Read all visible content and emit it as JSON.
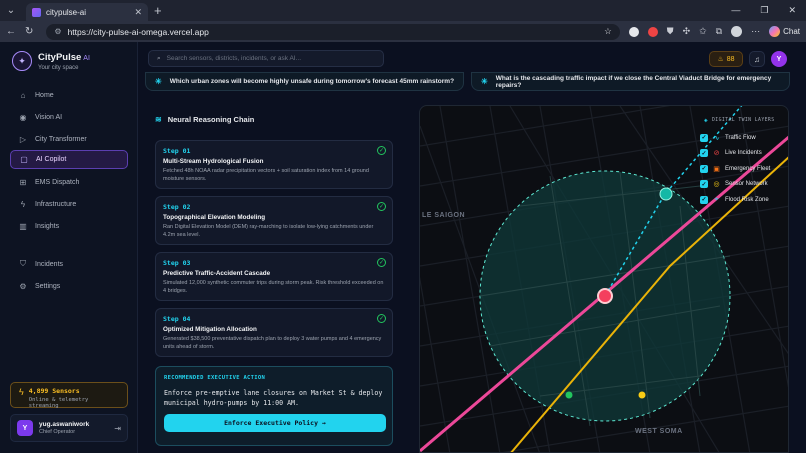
{
  "browser": {
    "tab_title": "citypulse-ai",
    "url": "https://city-pulse-ai-omega.vercel.app",
    "chat_label": "Chat"
  },
  "sidebar": {
    "brand": "CityPulse",
    "brand_ai": "AI",
    "tagline": "Your city space",
    "items": [
      {
        "label": "Home",
        "icon": "home-icon"
      },
      {
        "label": "Vision AI",
        "icon": "eye-icon"
      },
      {
        "label": "City Transformer",
        "icon": "play-icon"
      },
      {
        "label": "AI Copilot",
        "icon": "chat-icon",
        "active": true
      },
      {
        "label": "EMS Dispatch",
        "icon": "ambulance-icon"
      },
      {
        "label": "Infrastructure",
        "icon": "bolt-icon"
      },
      {
        "label": "Insights",
        "icon": "bar-chart-icon"
      },
      {
        "label": "Incidents",
        "icon": "shield-icon"
      },
      {
        "label": "Settings",
        "icon": "gear-icon"
      }
    ],
    "sensors_count": "4,899 Sensors",
    "sensors_status": "Online & telemetry streaming",
    "user": {
      "initial": "Y",
      "name": "yug.aswaniwork",
      "role": "Chief Operator"
    }
  },
  "topbar": {
    "search_placeholder": "Search sensors, districts, incidents, or ask AI...",
    "coins": "88",
    "avatar": "Y"
  },
  "queries": [
    "Which urban zones will become highly unsafe during tomorrow's forecast 45mm rainstorm?",
    "What is the cascading traffic impact if we close the Central Viaduct Bridge for emergency repairs?"
  ],
  "reasoning": {
    "title": "Neural Reasoning Chain",
    "steps": [
      {
        "num": "Step 01",
        "title": "Multi-Stream Hydrological Fusion",
        "desc": "Fetched 48h NOAA radar precipitation vectors + soil saturation index from 14 ground moisture sensors."
      },
      {
        "num": "Step 02",
        "title": "Topographical Elevation Modeling",
        "desc": "Ran Digital Elevation Model (DEM) ray-marching to isolate low-lying catchments under 4.2m sea level."
      },
      {
        "num": "Step 03",
        "title": "Predictive Traffic-Accident Cascade",
        "desc": "Simulated 12,000 synthetic commuter trips during storm peak. Risk threshold exceeded on 4 bridges."
      },
      {
        "num": "Step 04",
        "title": "Optimized Mitigation Allocation",
        "desc": "Generated $38,500 preventative dispatch plan to deploy 3 water pumps and 4 emergency units ahead of storm."
      }
    ]
  },
  "recommendation": {
    "label": "RECOMMENDED EXECUTIVE ACTION",
    "text": "Enforce pre-emptive lane closures on Market St & deploy municipal hydro-pumps by 11:00 AM.",
    "button": "Enforce Executive Policy"
  },
  "map": {
    "layers_title": "DIGITAL TWIN LAYERS",
    "layers": [
      {
        "label": "Traffic Flow",
        "color": "#22d3ee"
      },
      {
        "label": "Live Incidents",
        "color": "#ef4444"
      },
      {
        "label": "Emergency Fleet",
        "color": "#f97316"
      },
      {
        "label": "Sensor Network",
        "color": "#facc15"
      },
      {
        "label": "Flood Risk Zone",
        "color": "#22d3ee"
      }
    ],
    "district_labels": [
      "LE SAIGON",
      "WEST SOMA"
    ]
  },
  "colors": {
    "accent": "#22d3ee",
    "brand": "#a78bfa",
    "warning": "#fbbf24",
    "incident": "#f43f5e"
  }
}
